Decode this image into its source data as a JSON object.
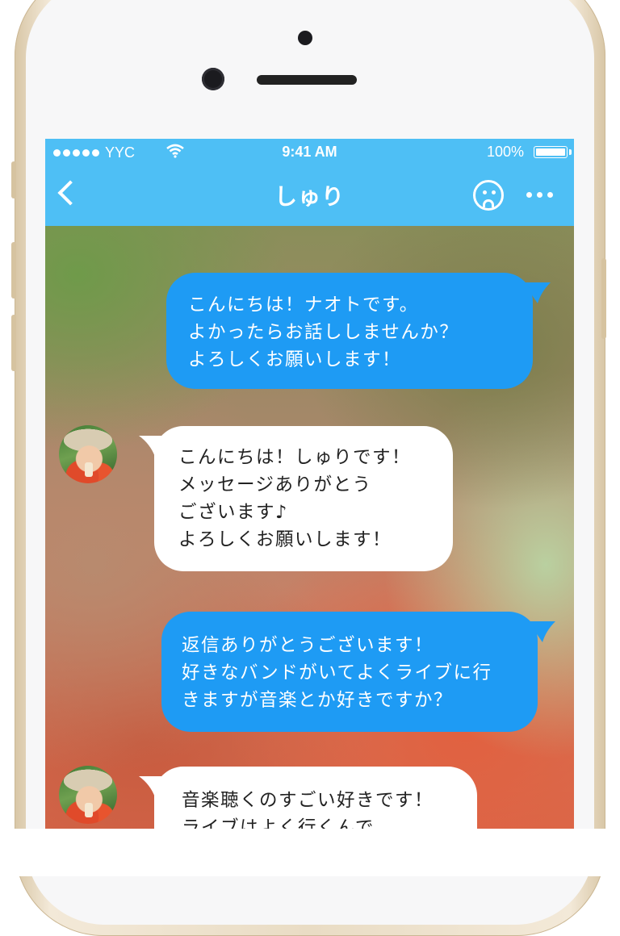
{
  "status_bar": {
    "carrier": "YYC",
    "time": "9:41 AM",
    "battery": "100%",
    "signal_dots": 5
  },
  "nav_bar": {
    "title": "しゅり",
    "left_icon": "back-chevron-icon",
    "right_icons": [
      "sad-face-icon",
      "more-icon"
    ]
  },
  "colors": {
    "bar": "#4ebff5",
    "outgoing_bubble": "#1e9bf4",
    "incoming_bubble": "#ffffff",
    "frame": "#e9dcc4"
  },
  "messages": [
    {
      "direction": "outgoing",
      "lines": [
        "こんにちは！ナオトです。",
        "よかったらお話ししませんか？",
        "よろしくお願いします！"
      ]
    },
    {
      "direction": "incoming",
      "lines": [
        "こんにちは！しゅりです！",
        "メッセージありがとう",
        "ございます♪",
        "よろしくお願いします！"
      ]
    },
    {
      "direction": "outgoing",
      "lines": [
        "返信ありがとうございます！",
        "好きなバンドがいてよくライブに行",
        "きますが音楽とか好きですか？"
      ]
    },
    {
      "direction": "incoming",
      "lines": [
        "音楽聴くのすごい好きです！",
        "ライブはよく行くんで"
      ]
    }
  ]
}
